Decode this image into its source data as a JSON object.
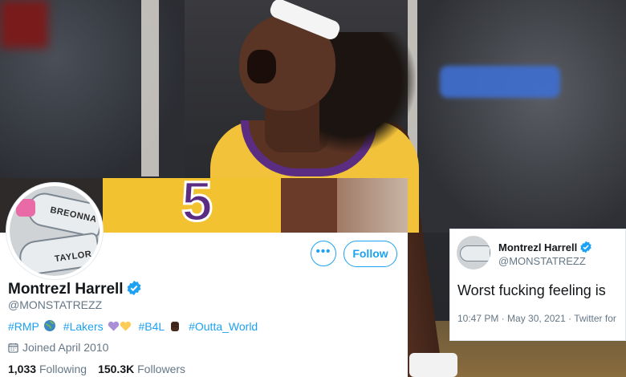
{
  "profile": {
    "display_name": "Montrezl Harrell",
    "handle": "@MONSTATREZZ",
    "more_label": "•••",
    "follow_label": "Follow",
    "bio": {
      "tag1": "#RMP",
      "tag2": "#Lakers",
      "tag3": "#B4L",
      "tag4": "#Outta_World"
    },
    "joined": "Joined April 2010",
    "following_count": "1,033",
    "following_label": "Following",
    "followers_count": "150.3K",
    "followers_label": "Followers",
    "avatar_text": {
      "shoe1": "BREONNA",
      "shoe2": "TAYLOR"
    },
    "banner_number": "5"
  },
  "tweet": {
    "display_name": "Montrezl Harrell",
    "handle": "@MONSTATREZZ",
    "text": "Worst fucking feeling is",
    "meta": "10:47 PM · May 30, 2021 · Twitter for"
  },
  "colors": {
    "twitter_blue": "#1da1f2",
    "lakers_gold": "#f2c230",
    "lakers_purple": "#5a2d82"
  },
  "icons": [
    "globe-icon",
    "purple-heart-icon",
    "yellow-heart-icon",
    "raised-fist-icon",
    "calendar-icon",
    "verified-badge-icon"
  ]
}
